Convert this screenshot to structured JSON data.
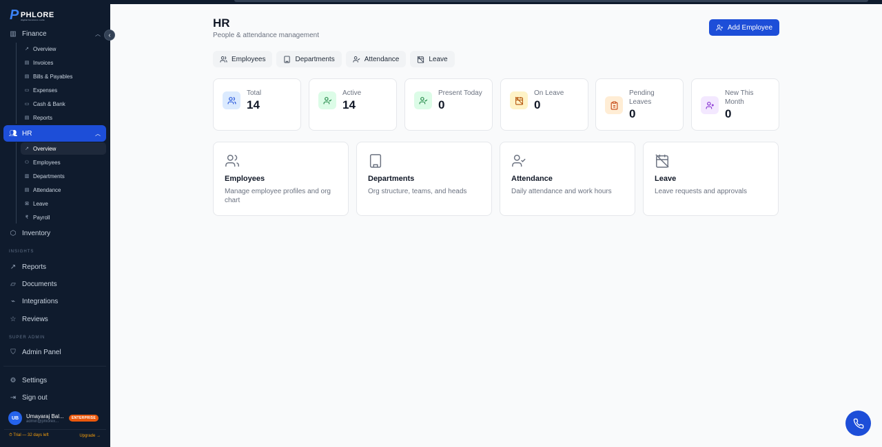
{
  "brand": {
    "name": "PHLORE",
    "tagline": "digital business suite"
  },
  "sidebar": {
    "finance": {
      "label": "Finance",
      "items": [
        "Overview",
        "Invoices",
        "Bills & Payables",
        "Expenses",
        "Cash & Bank",
        "Reports"
      ]
    },
    "hr": {
      "label": "HR",
      "items": [
        "Overview",
        "Employees",
        "Departments",
        "Attendance",
        "Leave",
        "Payroll"
      ],
      "active_item": "Overview"
    },
    "inventory": "Inventory",
    "insights_section": "INSIGHTS",
    "insights": [
      "Reports",
      "Documents",
      "Integrations",
      "Reviews"
    ],
    "super_admin_section": "SUPER ADMIN",
    "admin_panel": "Admin Panel",
    "settings": "Settings",
    "sign_out": "Sign out",
    "user": {
      "initials": "UB",
      "name": "Umayaraj Bal...",
      "email": "admin@phlorex...",
      "plan": "ENTERPRISE"
    },
    "trial": {
      "text": "⏱ Trial — 32 days left",
      "upgrade": "Upgrade →"
    }
  },
  "header": {
    "title": "HR",
    "subtitle": "People & attendance management",
    "add_button": "Add Employee"
  },
  "tabs": [
    "Employees",
    "Departments",
    "Attendance",
    "Leave"
  ],
  "stats": [
    {
      "label": "Total",
      "value": "14",
      "icon": "users-icon",
      "color": "#dbeafe",
      "fg": "#1d4ed8"
    },
    {
      "label": "Active",
      "value": "14",
      "icon": "user-check-icon",
      "color": "#dcfce7",
      "fg": "#15803d"
    },
    {
      "label": "Present Today",
      "value": "0",
      "icon": "user-check-icon",
      "color": "#dcfce7",
      "fg": "#15803d"
    },
    {
      "label": "On Leave",
      "value": "0",
      "icon": "calendar-off-icon",
      "color": "#fef3c7",
      "fg": "#b45309"
    },
    {
      "label": "Pending Leaves",
      "value": "0",
      "icon": "clipboard-icon",
      "color": "#ffedd5",
      "fg": "#c2410c"
    },
    {
      "label": "New This Month",
      "value": "0",
      "icon": "user-plus-icon",
      "color": "#f3e8ff",
      "fg": "#7e22ce"
    }
  ],
  "cards": [
    {
      "title": "Employees",
      "desc": "Manage employee profiles and org chart"
    },
    {
      "title": "Departments",
      "desc": "Org structure, teams, and heads"
    },
    {
      "title": "Attendance",
      "desc": "Daily attendance and work hours"
    },
    {
      "title": "Leave",
      "desc": "Leave requests and approvals"
    }
  ]
}
